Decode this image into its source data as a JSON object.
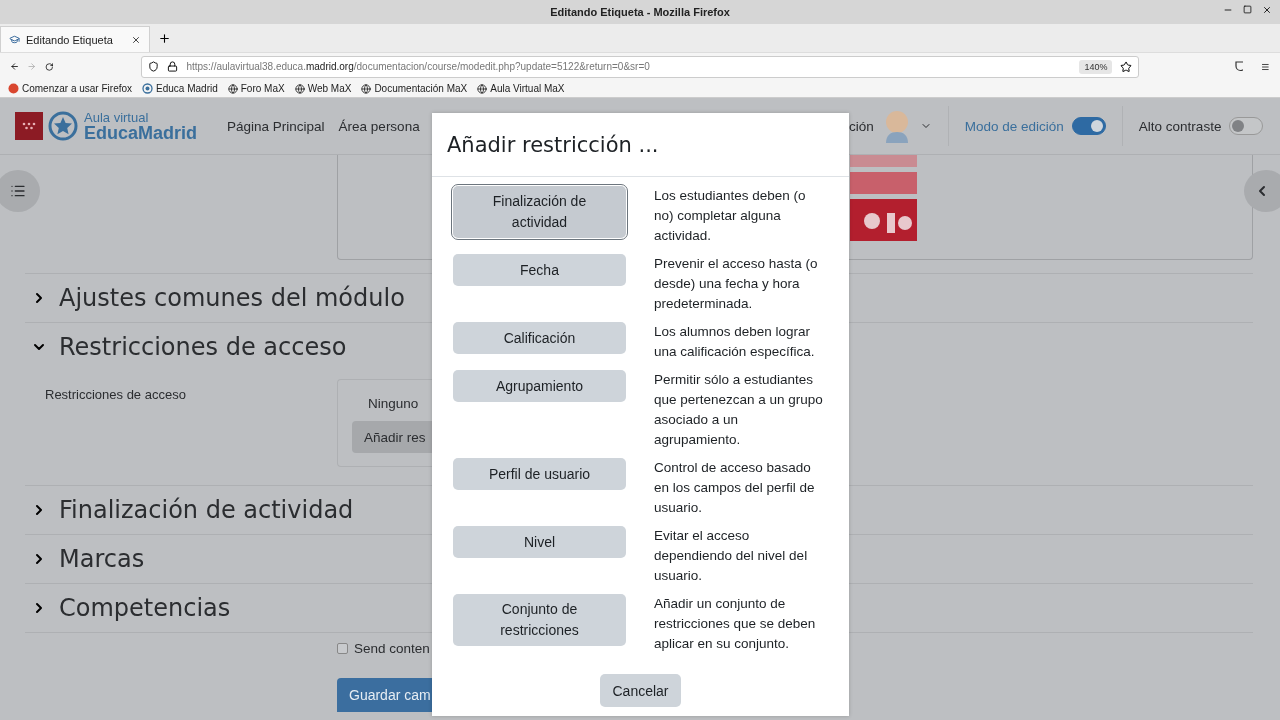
{
  "window": {
    "title": "Editando Etiqueta - Mozilla Firefox"
  },
  "tabs": [
    {
      "label": "Editando Etiqueta",
      "selected": true
    }
  ],
  "address_bar": {
    "url": "https://aulavirtual38.educa.**madrid.org**/documentacion/course/modedit.php?update=5122&return=0&sr=0",
    "zoom": "140%"
  },
  "bookmarks": [
    {
      "label": "Comenzar a usar Firefox",
      "kind": "firefox"
    },
    {
      "label": "Educa Madrid",
      "kind": "educa"
    },
    {
      "label": "Foro MaX",
      "kind": "globe"
    },
    {
      "label": "Web MaX",
      "kind": "globe"
    },
    {
      "label": "Documentación MaX",
      "kind": "globe"
    },
    {
      "label": "Aula Virtual MaX",
      "kind": "globe"
    }
  ],
  "site_header": {
    "logo": {
      "line_1": "Aula virtual",
      "line_2": "EducaMadrid"
    },
    "nav": [
      "Página Principal",
      "Área persona"
    ],
    "user_menu_label": "ción",
    "toggles": [
      {
        "label": "Modo de edición",
        "on": true
      },
      {
        "label": "Alto contraste",
        "on": false
      }
    ]
  },
  "sections": [
    {
      "title": "Ajustes comunes del módulo",
      "expanded": false
    },
    {
      "title": "Restricciones de acceso",
      "expanded": true,
      "field_label": "Restricciones de acceso",
      "value": "Ninguno",
      "button": "Añadir res"
    },
    {
      "title": "Finalización de actividad",
      "expanded": false
    },
    {
      "title": "Marcas",
      "expanded": false
    },
    {
      "title": "Competencias",
      "expanded": false
    }
  ],
  "send_checkbox": {
    "label": "Send conten",
    "checked": false
  },
  "save_button": "Guardar cam",
  "dialog": {
    "title": "Añadir restricción ...",
    "options": [
      {
        "button": "Finalización de actividad",
        "description": "Los estudiantes deben (o no) completar alguna actividad.",
        "selected": true
      },
      {
        "button": "Fecha",
        "description": "Prevenir el acceso hasta (o desde) una fecha y hora predeterminada.",
        "selected": false
      },
      {
        "button": "Calificación",
        "description": "Los alumnos deben lograr una calificación específica.",
        "selected": false
      },
      {
        "button": "Agrupamiento",
        "description": "Permitir sólo a estudiantes que pertenezcan a un grupo asociado a un agrupamiento.",
        "selected": false
      },
      {
        "button": "Perfil de usuario",
        "description": "Control de acceso basado en los campos del perfil de usuario.",
        "selected": false
      },
      {
        "button": "Nivel",
        "description": "Evitar el acceso dependiendo del nivel del usuario.",
        "selected": false
      },
      {
        "button": "Conjunto de restricciones",
        "description": "Añadir un conjunto de restricciones que se deben aplicar en su conjunto.",
        "selected": false
      }
    ],
    "cancel": "Cancelar"
  }
}
